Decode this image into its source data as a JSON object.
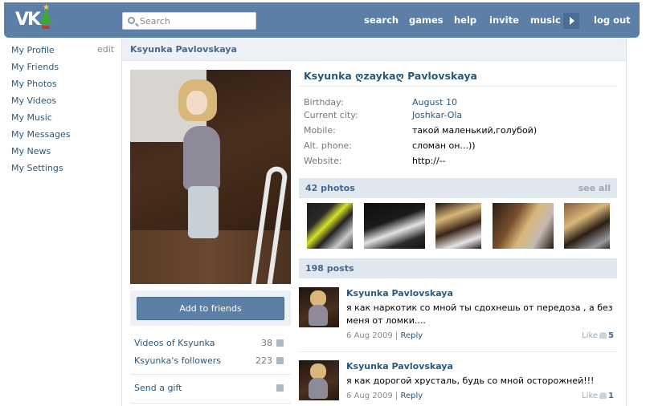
{
  "header": {
    "logo_text": "VK",
    "search_placeholder": "Search",
    "nav": [
      "search",
      "games",
      "help",
      "invite",
      "music",
      "log out"
    ]
  },
  "leftmenu": {
    "edit_label": "edit",
    "items": [
      "My Profile",
      "My Friends",
      "My Photos",
      "My Videos",
      "My Music",
      "My Messages",
      "My News",
      "My Settings"
    ]
  },
  "page": {
    "title": "Ksyunka Pavlovskaya"
  },
  "profile": {
    "full_name": "Ksyunka ღzaykaღ Pavlovskaya",
    "fields": [
      {
        "label": "Birthday:",
        "value": "August 10",
        "link": true
      },
      {
        "label": "Current city:",
        "value": "Joshkar-Ola",
        "link": true
      },
      {
        "label": "Mobile:",
        "value": "такой маленький,голубой)",
        "link": false
      },
      {
        "label": "Alt. phone:",
        "value": "сломан он...))",
        "link": false
      },
      {
        "label": "Website:",
        "value": "http://--",
        "link": false
      }
    ]
  },
  "actions": {
    "add_friend": "Add to friends"
  },
  "sidebar_links": [
    {
      "label": "Videos of Ksyunka",
      "count": "38"
    },
    {
      "label": "Ksyunka's followers",
      "count": "223"
    },
    {
      "label": "Send a gift",
      "count": ""
    }
  ],
  "photos": {
    "header": "42 photos",
    "see_all": "see all",
    "thumbs": [
      "photo-1",
      "photo-2",
      "photo-3",
      "photo-4",
      "photo-5"
    ]
  },
  "wall": {
    "header": "198 posts",
    "posts": [
      {
        "author": "Ksyunka Pavlovskaya",
        "text": "я как наркотик со мной ты сдохнешь от передоза , а без меня от ломки....",
        "date": "6 Aug 2009",
        "sep": "|",
        "reply": "Reply",
        "like_label": "Like",
        "likes": "5"
      },
      {
        "author": "Ksyunka Pavlovskaya",
        "text": "я как дорогой хрусталь, будь со мной осторожней!!!",
        "date": "6 Aug 2009",
        "sep": "|",
        "reply": "Reply",
        "like_label": "Like",
        "likes": "1"
      }
    ]
  }
}
